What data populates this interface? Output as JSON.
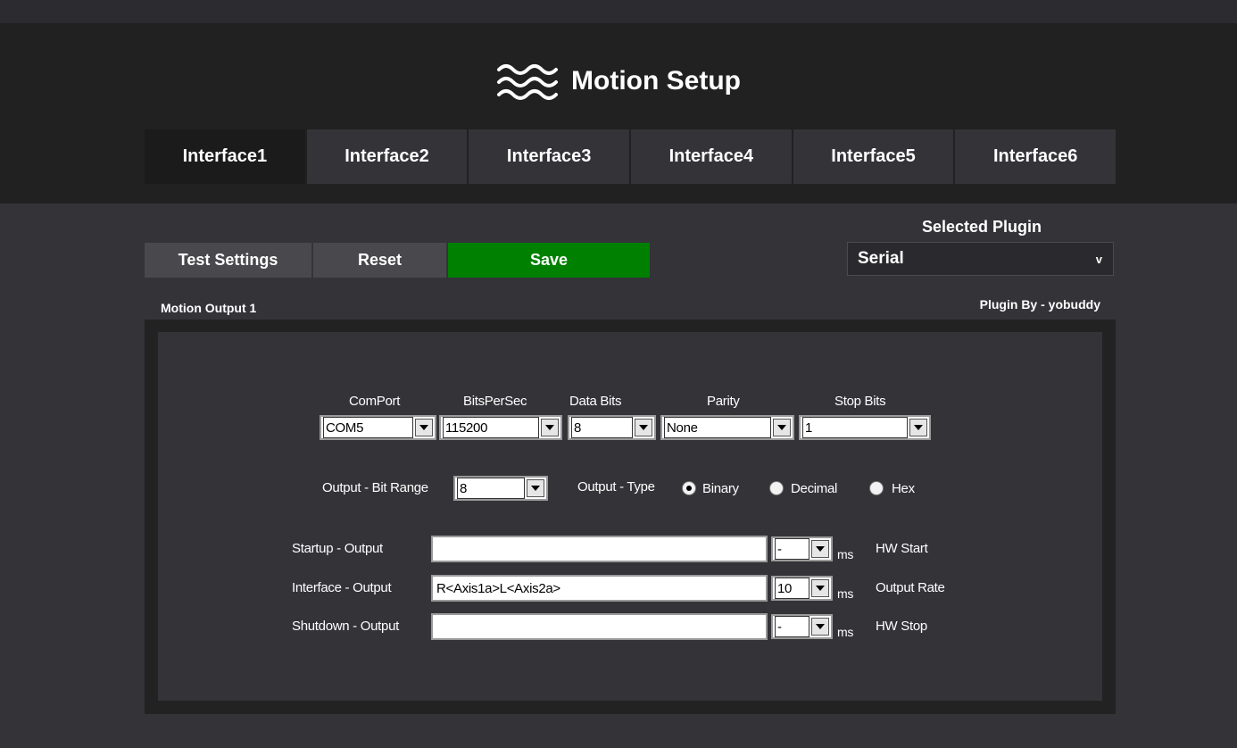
{
  "app": {
    "title": "Motion Setup",
    "logo_icon": "waves-icon"
  },
  "tabs": [
    {
      "label": "Interface1",
      "active": true
    },
    {
      "label": "Interface2",
      "active": false
    },
    {
      "label": "Interface3",
      "active": false
    },
    {
      "label": "Interface4",
      "active": false
    },
    {
      "label": "Interface5",
      "active": false
    },
    {
      "label": "Interface6",
      "active": false
    }
  ],
  "toolbar": {
    "test_label": "Test Settings",
    "reset_label": "Reset",
    "save_label": "Save",
    "save_color": "#008000"
  },
  "plugin": {
    "label": "Selected Plugin",
    "value": "Serial",
    "chevron": "v",
    "by": "Plugin By - yobuddy"
  },
  "section": {
    "title": "Motion Output 1"
  },
  "serial": {
    "comport": {
      "label": "ComPort",
      "value": "COM5"
    },
    "bits_per_sec": {
      "label": "BitsPerSec",
      "value": "115200"
    },
    "data_bits": {
      "label": "Data Bits",
      "value": "8"
    },
    "parity": {
      "label": "Parity",
      "value": "None"
    },
    "stop_bits": {
      "label": "Stop Bits",
      "value": "1"
    }
  },
  "output": {
    "bit_range_label": "Output - Bit Range",
    "bit_range_value": "8",
    "type_label": "Output - Type",
    "types": [
      {
        "label": "Binary",
        "checked": true
      },
      {
        "label": "Decimal",
        "checked": false
      },
      {
        "label": "Hex",
        "checked": false
      }
    ]
  },
  "rows": [
    {
      "label": "Startup - Output",
      "value": "",
      "delay": "-",
      "unit": "ms",
      "note": "HW Start"
    },
    {
      "label": "Interface - Output",
      "value": "R<Axis1a>L<Axis2a>",
      "delay": "10",
      "unit": "ms",
      "note": "Output Rate"
    },
    {
      "label": "Shutdown - Output",
      "value": "",
      "delay": "-",
      "unit": "ms",
      "note": "HW Stop"
    }
  ]
}
